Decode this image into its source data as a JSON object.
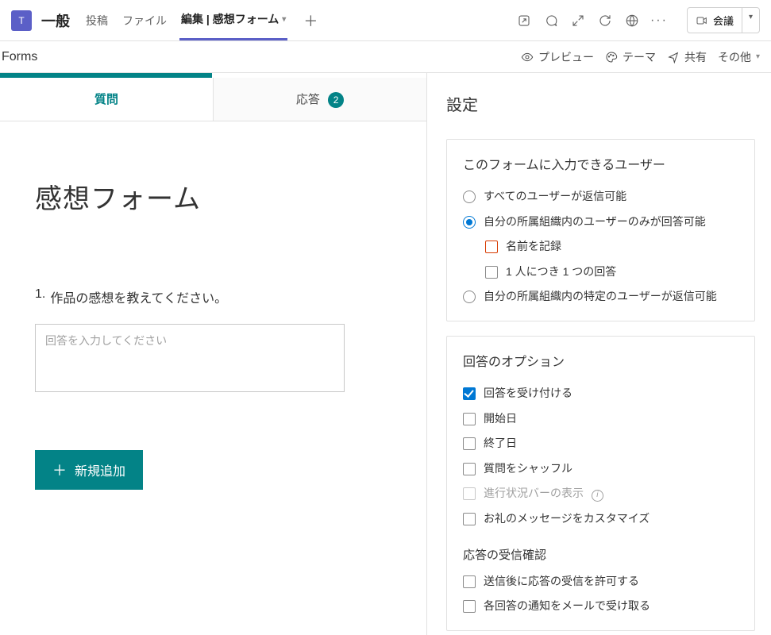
{
  "topbar": {
    "team_initial": "T",
    "channel": "一般",
    "tabs": {
      "posts": "投稿",
      "files": "ファイル",
      "active": "編集 | 感想フォーム"
    },
    "meeting_label": "会議"
  },
  "formsbar": {
    "title": "Forms",
    "actions": {
      "preview": "プレビュー",
      "theme": "テーマ",
      "share": "共有",
      "other": "その他"
    }
  },
  "editor": {
    "tabs": {
      "questions": "質問",
      "responses": "応答",
      "response_count": "2"
    },
    "form_title": "感想フォーム",
    "question": {
      "num": "1.",
      "text": "作品の感想を教えてください。",
      "placeholder": "回答を入力してください"
    },
    "add_button": "新規追加"
  },
  "settings": {
    "title": "設定",
    "who": {
      "title": "このフォームに入力できるユーザー",
      "opt1": "すべてのユーザーが返信可能",
      "opt2": "自分の所属組織内のユーザーのみが回答可能",
      "opt2a": "名前を記録",
      "opt2b": "1 人につき 1 つの回答",
      "opt3": "自分の所属組織内の特定のユーザーが返信可能"
    },
    "options": {
      "title": "回答のオプション",
      "accept": "回答を受け付ける",
      "start": "開始日",
      "end": "終了日",
      "shuffle": "質問をシャッフル",
      "progress": "進行状況バーの表示",
      "thanks": "お礼のメッセージをカスタマイズ"
    },
    "receipt": {
      "title": "応答の受信確認",
      "allow": "送信後に応答の受信を許可する",
      "email": "各回答の通知をメールで受け取る"
    }
  }
}
